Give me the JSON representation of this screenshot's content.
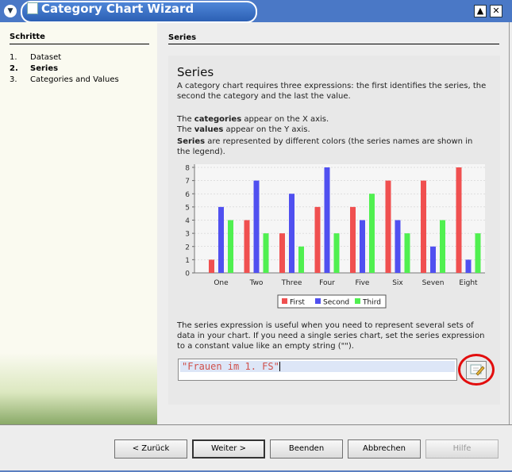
{
  "window": {
    "title": "Category Chart Wizard"
  },
  "steps": {
    "heading": "Schritte",
    "items": [
      {
        "num": "1.",
        "label": "Dataset"
      },
      {
        "num": "2.",
        "label": "Series"
      },
      {
        "num": "3.",
        "label": "Categories and Values"
      }
    ]
  },
  "panel": {
    "header": "Series",
    "title": "Series",
    "intro": "A category chart requires three expressions: the first identifies the series, the second the category and the last the value.",
    "cat_bold": "categories",
    "cat_rest": " appear on the X axis.",
    "val_bold": "values",
    "val_rest": " appear on the Y axis.",
    "ser_bold": "Series",
    "ser_rest": " are represented by different colors (the series names are shown in the legend).",
    "the1": "The ",
    "the2": "The ",
    "help": "The series expression is useful when you need to represent several sets of data in your chart. If you need a single series chart, set the series expression to a constant value like an empty string (\"\").",
    "expression_value": "\"Frauen im 1. FS\""
  },
  "buttons": {
    "back": "< Zurück",
    "next": "Weiter >",
    "finish": "Beenden",
    "cancel": "Abbrechen",
    "help": "Hilfe"
  },
  "colors": {
    "first": "#f05050",
    "second": "#5050f0",
    "third": "#50f050",
    "accent": "#4a78c6"
  },
  "chart_data": {
    "type": "bar",
    "categories": [
      "One",
      "Two",
      "Three",
      "Four",
      "Five",
      "Six",
      "Seven",
      "Eight"
    ],
    "series": [
      {
        "name": "First",
        "values": [
          1,
          4,
          3,
          5,
          5,
          7,
          7,
          8
        ]
      },
      {
        "name": "Second",
        "values": [
          5,
          7,
          6,
          8,
          4,
          4,
          2,
          1
        ]
      },
      {
        "name": "Third",
        "values": [
          4,
          3,
          2,
          3,
          6,
          3,
          4,
          3
        ]
      }
    ],
    "ylim": [
      0,
      8
    ],
    "yticks": [
      "0",
      "1",
      "2",
      "3",
      "4",
      "5",
      "6",
      "7",
      "8"
    ],
    "legend": "bottom"
  }
}
